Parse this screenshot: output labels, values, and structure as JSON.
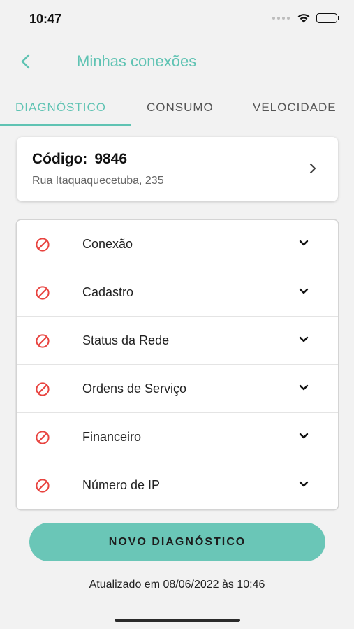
{
  "status_bar": {
    "time": "10:47",
    "signal_icon": "cellular-dots-icon",
    "wifi_icon": "wifi-icon",
    "battery_icon": "battery-icon",
    "battery_level": 1.0
  },
  "header": {
    "back_icon": "chevron-left-icon",
    "title": "Minhas conexões"
  },
  "tabs": [
    {
      "label": "DIAGNÓSTICO",
      "active": true
    },
    {
      "label": "CONSUMO",
      "active": false
    },
    {
      "label": "VELOCIDADE",
      "active": false
    }
  ],
  "contract": {
    "code_label": "Código:",
    "code_value": "9846",
    "address": "Rua Itaquaquecetuba, 235",
    "arrow_icon": "chevron-right-icon"
  },
  "diagnostics": [
    {
      "label": "Conexão",
      "status_icon": "blocked-icon",
      "expand_icon": "chevron-down-icon"
    },
    {
      "label": "Cadastro",
      "status_icon": "blocked-icon",
      "expand_icon": "chevron-down-icon"
    },
    {
      "label": "Status da Rede",
      "status_icon": "blocked-icon",
      "expand_icon": "chevron-down-icon"
    },
    {
      "label": "Ordens de Serviço",
      "status_icon": "blocked-icon",
      "expand_icon": "chevron-down-icon"
    },
    {
      "label": "Financeiro",
      "status_icon": "blocked-icon",
      "expand_icon": "chevron-down-icon"
    },
    {
      "label": "Número de IP",
      "status_icon": "blocked-icon",
      "expand_icon": "chevron-down-icon"
    }
  ],
  "action": {
    "new_diagnostic_label": "NOVO DIAGNÓSTICO"
  },
  "footer": {
    "updated_text": "Atualizado em 08/06/2022 às 10:46"
  },
  "colors": {
    "accent": "#5fc3b3",
    "button": "#6ac6b7",
    "error": "#e8433f",
    "background": "#f2f2f2"
  }
}
